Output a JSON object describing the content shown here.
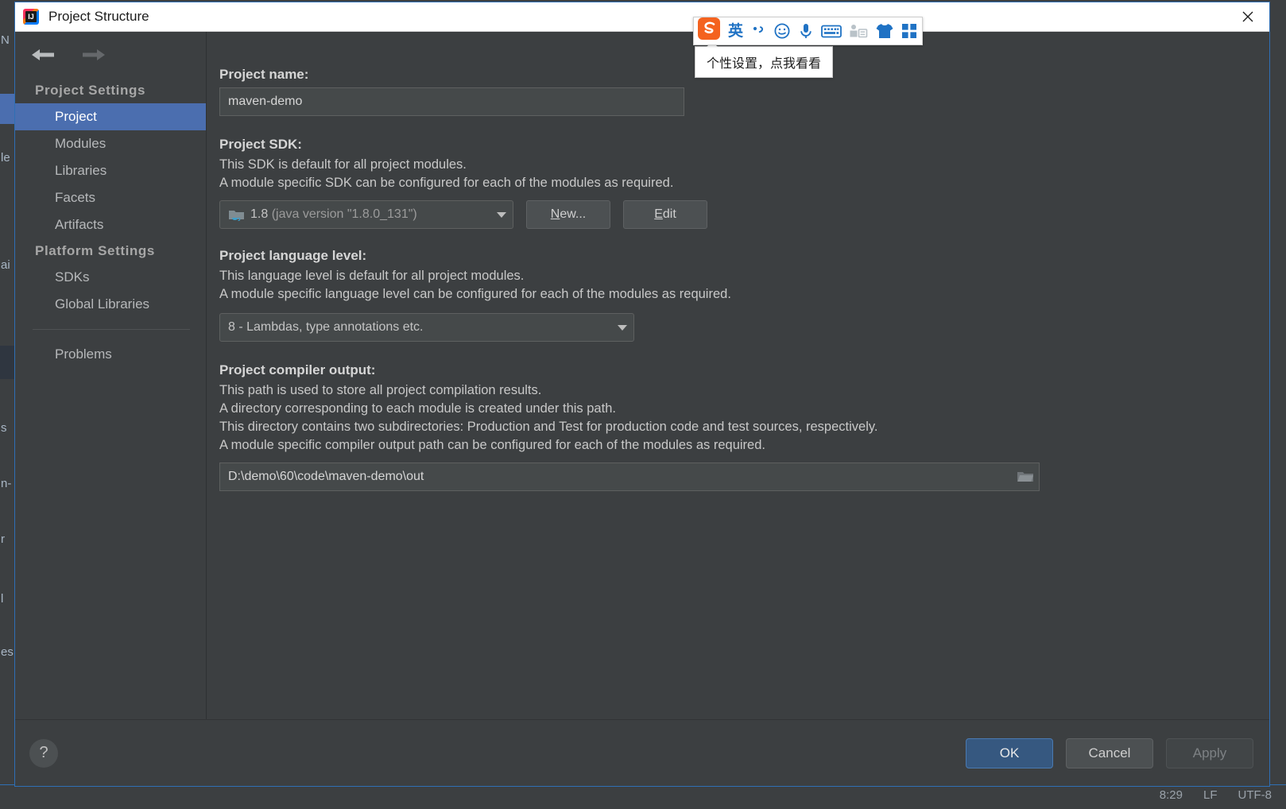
{
  "window": {
    "title": "Project Structure",
    "app_icon": "intellij-idea-icon",
    "close_label": "×"
  },
  "navigation": {
    "back_icon": "arrow-left-icon",
    "forward_icon": "arrow-right-icon"
  },
  "sidebar": {
    "groups": [
      {
        "title": "Project Settings",
        "items": [
          {
            "label": "Project",
            "selected": true
          },
          {
            "label": "Modules",
            "selected": false
          },
          {
            "label": "Libraries",
            "selected": false
          },
          {
            "label": "Facets",
            "selected": false
          },
          {
            "label": "Artifacts",
            "selected": false
          }
        ]
      },
      {
        "title": "Platform Settings",
        "items": [
          {
            "label": "SDKs",
            "selected": false
          },
          {
            "label": "Global Libraries",
            "selected": false
          }
        ]
      }
    ],
    "footer_items": [
      {
        "label": "Problems",
        "selected": false
      }
    ]
  },
  "main": {
    "project_name": {
      "label": "Project name:",
      "value": "maven-demo",
      "placeholder": ""
    },
    "project_sdk": {
      "label": "Project SDK:",
      "descriptions": [
        "This SDK is default for all project modules.",
        "A module specific SDK can be configured for each of the modules as required."
      ],
      "selected_value": "1.8",
      "selected_detail": "(java version \"1.8.0_131\")",
      "sdk_icon": "java-sdk-folder-icon",
      "new_button": {
        "prefix": "N",
        "suffix": "ew..."
      },
      "edit_button": {
        "prefix": "E",
        "suffix": "dit"
      }
    },
    "project_language_level": {
      "label": "Project language level:",
      "descriptions": [
        "This language level is default for all project modules.",
        "A module specific language level can be configured for each of the modules as required."
      ],
      "selected_value": "8 - Lambdas, type annotations etc."
    },
    "project_compiler_output": {
      "label": "Project compiler output:",
      "descriptions": [
        "This path is used to store all project compilation results.",
        "A directory corresponding to each module is created under this path.",
        "This directory contains two subdirectories: Production and Test for production code and test sources, respectively.",
        "A module specific compiler output path can be configured for each of the modules as required."
      ],
      "path_value": "D:\\demo\\60\\code\\maven-demo\\out",
      "browse_icon": "folder-browse-icon"
    }
  },
  "footer": {
    "help_label": "?",
    "help_icon": "question-mark-icon",
    "ok_label": "OK",
    "cancel_label": "Cancel",
    "apply_label": "Apply"
  },
  "ime_toolbar": {
    "logo_icon": "sogou-logo-icon",
    "items": [
      {
        "icon": "chinese-english-mode-icon",
        "label": "英"
      },
      {
        "icon": "punctuation-mode-icon",
        "label": ""
      },
      {
        "icon": "emoji-icon",
        "label": ""
      },
      {
        "icon": "microphone-icon",
        "label": ""
      },
      {
        "icon": "soft-keyboard-icon",
        "label": ""
      },
      {
        "icon": "toolbox-icon",
        "label": ""
      },
      {
        "icon": "skin-shirt-icon",
        "label": ""
      },
      {
        "icon": "app-grid-icon",
        "label": ""
      }
    ],
    "tooltip": "个性设置，点我看看"
  },
  "ide_background": {
    "status_items": [
      "8:29",
      "LF",
      "UTF-8"
    ],
    "gutter_fragments": [
      "N",
      "le",
      "ai",
      "s",
      "n-",
      "r",
      "l",
      "es"
    ]
  },
  "colors": {
    "dialog_bg": "#3c3f41",
    "selection_blue": "#4b6eaf",
    "primary_button": "#365880",
    "window_border": "#2f6fb5",
    "titlebar_bg": "#ffffff",
    "text_primary": "#d6d6d6",
    "ime_blue": "#1f72c4",
    "sogou_orange": "#f4621f"
  }
}
